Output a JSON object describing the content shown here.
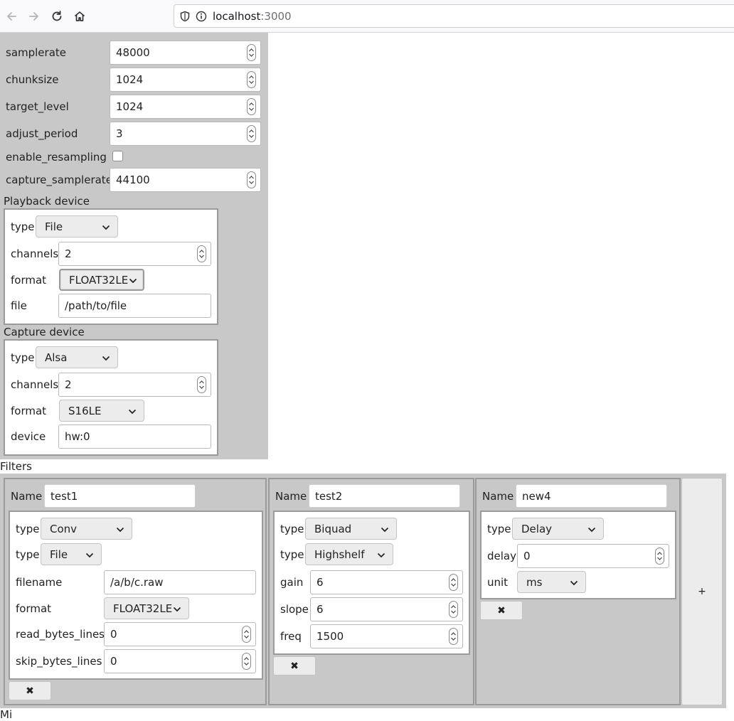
{
  "browser": {
    "url_host": "localhost",
    "url_port": ":3000"
  },
  "devices": {
    "fields": [
      {
        "label": "samplerate",
        "value": "48000"
      },
      {
        "label": "chunksize",
        "value": "1024"
      },
      {
        "label": "target_level",
        "value": "1024"
      },
      {
        "label": "adjust_period",
        "value": "3"
      }
    ],
    "enable_resampling": {
      "label": "enable_resampling",
      "checked": false
    },
    "capture_samplerate": {
      "label": "capture_samplerate",
      "value": "44100"
    },
    "playback": {
      "title": "Playback device",
      "type_label": "type",
      "type_value": "File",
      "channels_label": "channels",
      "channels_value": "2",
      "format_label": "format",
      "format_value": "FLOAT32LE",
      "file_label": "file",
      "file_value": "/path/to/file"
    },
    "capture": {
      "title": "Capture device",
      "type_label": "type",
      "type_value": "Alsa",
      "channels_label": "channels",
      "channels_value": "2",
      "format_label": "format",
      "format_value": "S16LE",
      "device_label": "device",
      "device_value": "hw:0"
    }
  },
  "filters": {
    "title": "Filters",
    "delete_symbol": "✖",
    "add_symbol": "+",
    "name_label": "Name",
    "items": [
      {
        "name": "test1",
        "type_label": "type",
        "type": "Conv",
        "subtype_label": "type",
        "subtype": "File",
        "filename_label": "filename",
        "filename": "/a/b/c.raw",
        "format_label": "format",
        "format": "FLOAT32LE",
        "read_label": "read_bytes_lines",
        "read": "0",
        "skip_label": "skip_bytes_lines",
        "skip": "0"
      },
      {
        "name": "test2",
        "type_label": "type",
        "type": "Biquad",
        "subtype_label": "type",
        "subtype": "Highshelf",
        "gain_label": "gain",
        "gain": "6",
        "slope_label": "slope",
        "slope": "6",
        "freq_label": "freq",
        "freq": "1500"
      },
      {
        "name": "new4",
        "type_label": "type",
        "type": "Delay",
        "delay_label": "delay",
        "delay": "0",
        "unit_label": "unit",
        "unit": "ms"
      }
    ]
  },
  "footer": {
    "partial_label": "Mi"
  },
  "colors": {
    "panel": "#c8c8c8",
    "box_border": "#9b9b9b",
    "button": "#ececec"
  }
}
